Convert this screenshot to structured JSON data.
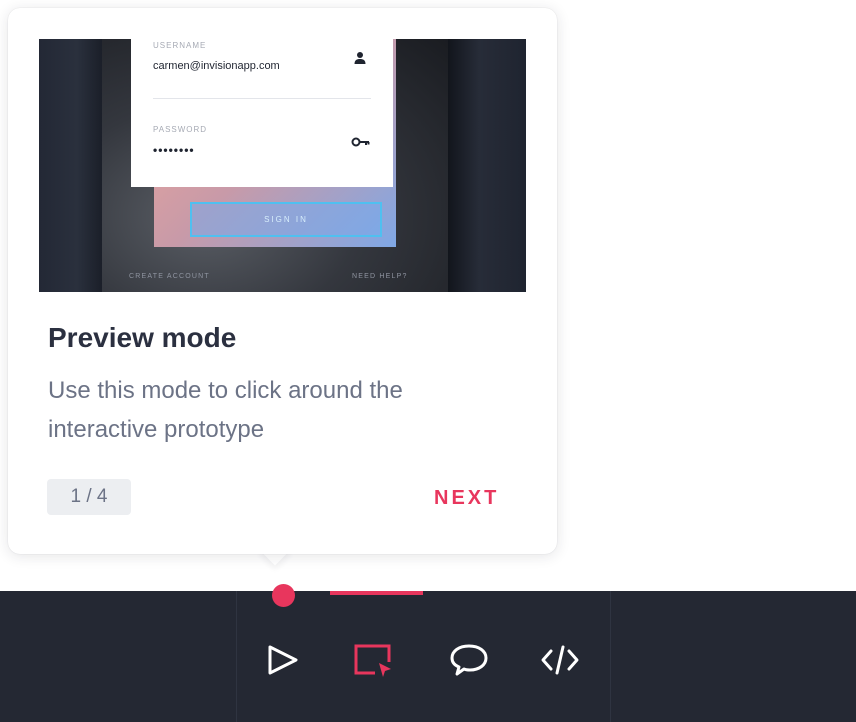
{
  "tooltip": {
    "title": "Preview mode",
    "description": "Use this mode to click around the interactive prototype",
    "pager": "1 / 4",
    "next_label": "NEXT",
    "preview_image": {
      "username_label": "USERNAME",
      "username_value": "carmen@invisionapp.com",
      "password_label": "PASSWORD",
      "password_value": "••••••••",
      "signin_label": "SIGN IN",
      "create_account_label": "CREATE ACCOUNT",
      "need_help_label": "NEED HELP?",
      "user_icon": "user-icon",
      "key_icon": "key-icon"
    }
  },
  "toolbar": {
    "tools": [
      {
        "name": "preview",
        "icon": "play-icon",
        "active": false
      },
      {
        "name": "inspect",
        "icon": "cursor-box-icon",
        "active": true
      },
      {
        "name": "comment",
        "icon": "comment-bubble-icon",
        "active": false
      },
      {
        "name": "code",
        "icon": "code-icon",
        "active": false
      }
    ]
  },
  "colors": {
    "accent": "#e8365d",
    "toolbar_bg": "#242833",
    "icon_default": "#ffffff",
    "title_text": "#2b3040",
    "body_text": "#6c7386",
    "pager_bg": "#eceef1"
  }
}
